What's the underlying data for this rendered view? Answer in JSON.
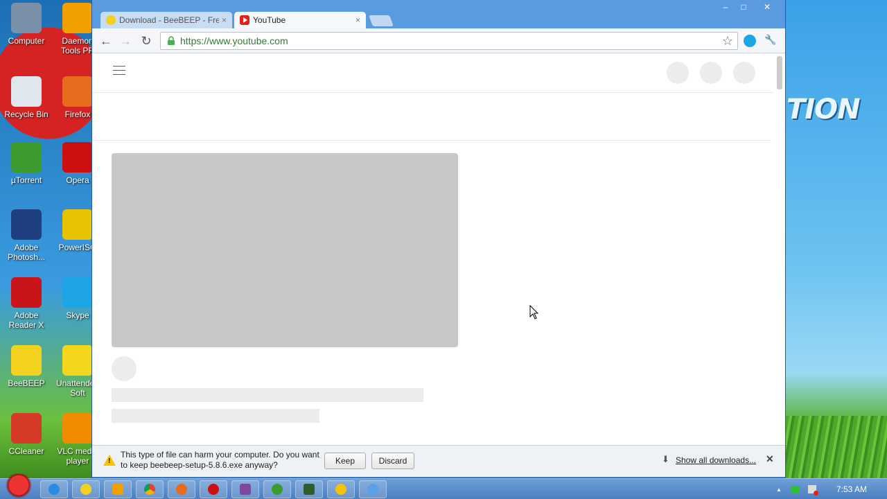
{
  "desktop": {
    "wallpaper_text": "TION",
    "icons": [
      {
        "label": "Computer",
        "icon": "computer-icon",
        "color": "#7a8fa8"
      },
      {
        "label": "Daemon Tools PR",
        "icon": "daemon-tools-icon",
        "color": "#f2a000"
      },
      {
        "label": "Recycle Bin",
        "icon": "recycle-bin-icon",
        "color": "#dfe6ee"
      },
      {
        "label": "Firefox",
        "icon": "firefox-icon",
        "color": "#e86a1c"
      },
      {
        "label": "µTorrent",
        "icon": "utorrent-icon",
        "color": "#3b9b2e"
      },
      {
        "label": "Opera",
        "icon": "opera-icon",
        "color": "#cc1010"
      },
      {
        "label": "Adobe Photosh...",
        "icon": "photoshop-icon",
        "color": "#1f3f80"
      },
      {
        "label": "PowerISO",
        "icon": "poweriso-icon",
        "color": "#e6c200"
      },
      {
        "label": "Adobe Reader X",
        "icon": "adobe-reader-icon",
        "color": "#c9141a"
      },
      {
        "label": "Skype",
        "icon": "skype-icon",
        "color": "#1ea5e6"
      },
      {
        "label": "BeeBEEP",
        "icon": "beebeep-icon",
        "color": "#f2d21f"
      },
      {
        "label": "Unattended Soft",
        "icon": "star-icon",
        "color": "#f4d71c"
      },
      {
        "label": "CCleaner",
        "icon": "ccleaner-icon",
        "color": "#d53a27"
      },
      {
        "label": "VLC media player",
        "icon": "vlc-icon",
        "color": "#f18b00"
      }
    ]
  },
  "browser": {
    "tabs": [
      {
        "label": "Download - BeeBEEP - Fre",
        "close": "×"
      },
      {
        "label": "YouTube",
        "close": "×"
      }
    ],
    "window_controls": {
      "minimize": "–",
      "maximize": "□",
      "close": "✕"
    },
    "nav": {
      "back": "←",
      "forward": "→",
      "reload": "↻"
    },
    "url": "https://www.youtube.com",
    "star": "☆",
    "wrench": "🔧"
  },
  "download_bar": {
    "message": "This type of file can harm your computer. Do you want to keep beebeep-setup-5.8.6.exe anyway?",
    "keep_label": "Keep",
    "discard_label": "Discard",
    "show_all_label": "Show all downloads...",
    "close": "✕"
  },
  "taskbar": {
    "clock": "7:53 AM",
    "tray_arrow": "▲"
  },
  "colors": {
    "accent": "#4e8fd8",
    "placeholder": "#c8c8c8",
    "url_green": "#2e7d32"
  }
}
